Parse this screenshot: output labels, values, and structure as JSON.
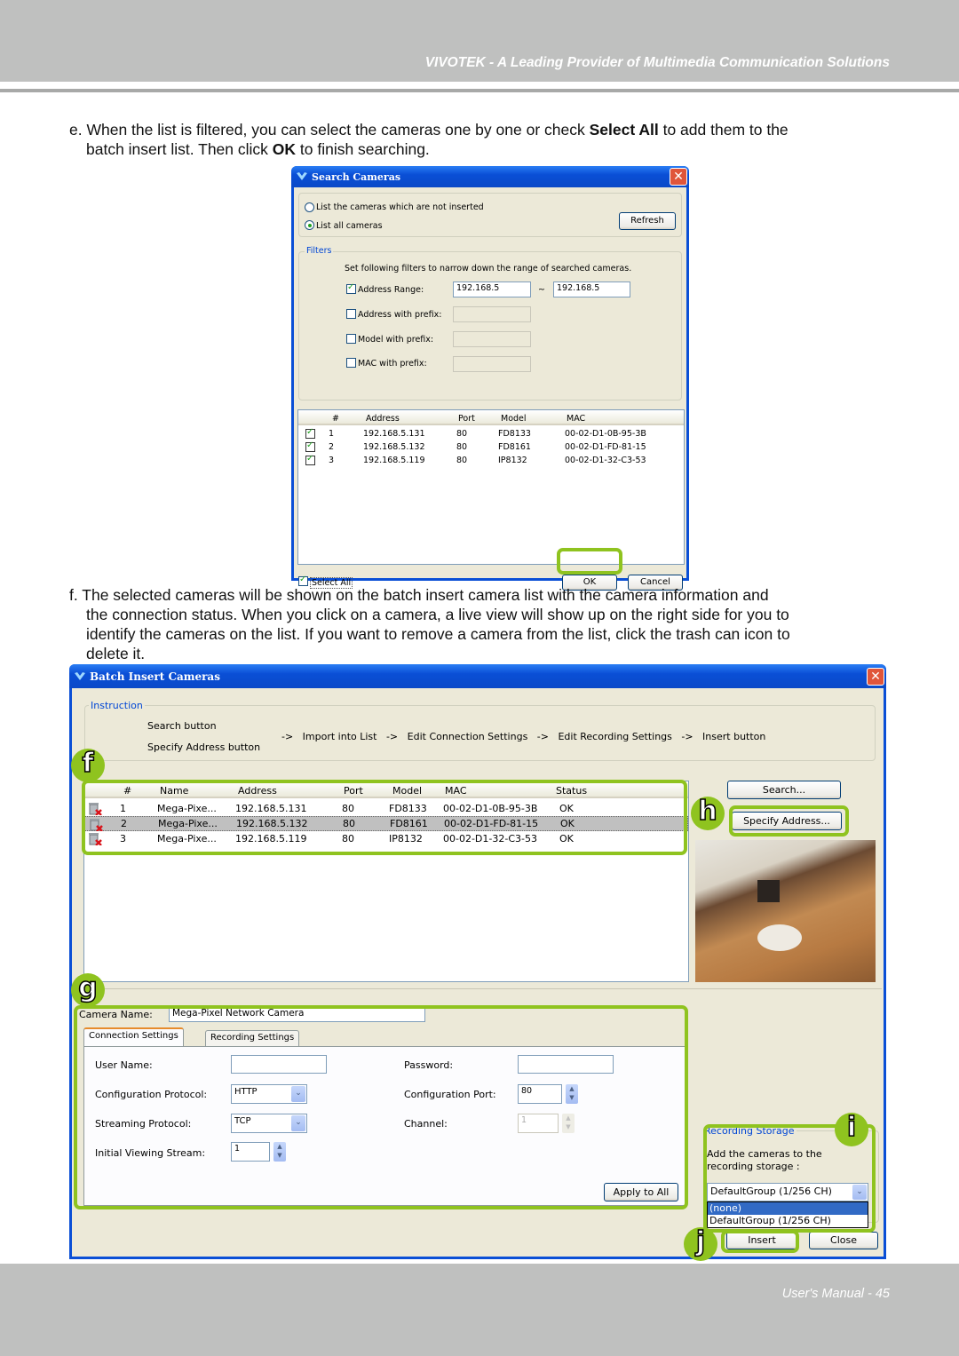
{
  "header": {
    "title": "VIVOTEK - A Leading Provider of Multimedia Communication Solutions"
  },
  "steps": {
    "e": {
      "prefix": "e. ",
      "line1_a": "When the list is filtered, you can select the cameras one by one or check ",
      "bold1": "Select All",
      "line1_b": " to add them to the",
      "line2_a": "batch insert list. Then click ",
      "bold2": "OK",
      "line2_b": " to finish searching."
    },
    "f": {
      "text1": "f. The selected cameras will be shown on the batch insert camera list with the camera information and",
      "text2": "the connection status. When you click on a camera, a live view will show up on the right side for you to",
      "text3": "identify the cameras on the list. If you want to remove a camera from the list, click the trash can icon to",
      "text4": "delete it."
    }
  },
  "search_dialog": {
    "title": "Search Cameras",
    "radio_not_inserted": "List the cameras which are not inserted",
    "radio_all": "List all cameras",
    "refresh_label": "Refresh",
    "filters_legend": "Filters",
    "filters_hint": "Set following filters to narrow down the range of searched cameras.",
    "address_range_label": "Address Range:",
    "address_range_from": "192.168.5",
    "address_range_sep": "~",
    "address_range_to": "192.168.5",
    "address_prefix_label": "Address with prefix:",
    "model_prefix_label": "Model with prefix:",
    "mac_prefix_label": "MAC with prefix:",
    "columns": [
      "#",
      "Address",
      "Port",
      "Model",
      "MAC"
    ],
    "rows": [
      {
        "num": "1",
        "address": "192.168.5.131",
        "port": "80",
        "model": "FD8133",
        "mac": "00-02-D1-0B-95-3B",
        "checked": true
      },
      {
        "num": "2",
        "address": "192.168.5.132",
        "port": "80",
        "model": "FD8161",
        "mac": "00-02-D1-FD-81-15",
        "checked": true
      },
      {
        "num": "3",
        "address": "192.168.5.119",
        "port": "80",
        "model": "IP8132",
        "mac": "00-02-D1-32-C3-53",
        "checked": true
      }
    ],
    "select_all_label": "Select All",
    "ok_label": "OK",
    "cancel_label": "Cancel"
  },
  "batch_dialog": {
    "title": "Batch Insert Cameras",
    "instruction_legend": "Instruction",
    "instr_search": "Search button",
    "instr_specify": "Specify Address button",
    "instr_flow": "->   Import into List   ->   Edit Connection Settings   ->   Edit Recording Settings   ->   Insert button",
    "columns": [
      "#",
      "Name",
      "Address",
      "Port",
      "Model",
      "MAC",
      "Status"
    ],
    "rows": [
      {
        "num": "1",
        "name": "Mega-Pixe...",
        "address": "192.168.5.131",
        "port": "80",
        "model": "FD8133",
        "mac": "00-02-D1-0B-95-3B",
        "status": "OK"
      },
      {
        "num": "2",
        "name": "Mega-Pixe...",
        "address": "192.168.5.132",
        "port": "80",
        "model": "FD8161",
        "mac": "00-02-D1-FD-81-15",
        "status": "OK"
      },
      {
        "num": "3",
        "name": "Mega-Pixe...",
        "address": "192.168.5.119",
        "port": "80",
        "model": "IP8132",
        "mac": "00-02-D1-32-C3-53",
        "status": "OK"
      }
    ],
    "search_button": "Search...",
    "specify_button": "Specify Address...",
    "camera_name_label": "Camera Name:",
    "camera_name_value": "Mega-Pixel Network Camera",
    "tab_connection": "Connection Settings",
    "tab_recording": "Recording Settings",
    "user_name_label": "User Name:",
    "password_label": "Password:",
    "config_protocol_label": "Configuration Protocol:",
    "config_protocol_value": "HTTP",
    "config_port_label": "Configuration Port:",
    "config_port_value": "80",
    "streaming_protocol_label": "Streaming Protocol:",
    "streaming_protocol_value": "TCP",
    "channel_label": "Channel:",
    "channel_value": "1",
    "initial_stream_label": "Initial Viewing Stream:",
    "initial_stream_value": "1",
    "apply_all_label": "Apply to All",
    "storage_legend": "Recording Storage",
    "storage_hint1": "Add the cameras to the",
    "storage_hint2": "recording storage :",
    "storage_selected": "DefaultGroup (1/256 CH)",
    "storage_options": [
      "(none)",
      "DefaultGroup (1/256 CH)"
    ],
    "insert_label": "Insert",
    "close_label": "Close"
  },
  "callouts": {
    "f": "f",
    "g": "g",
    "h": "h",
    "i": "i",
    "j": "j"
  },
  "colors": {
    "highlight": "#8fc31f",
    "xp_title_blue": "#0a4fd6",
    "dialog_bg": "#ece9d8",
    "header_gray": "#bfc0bf"
  },
  "footer": {
    "page_label": "User's Manual - 45"
  }
}
